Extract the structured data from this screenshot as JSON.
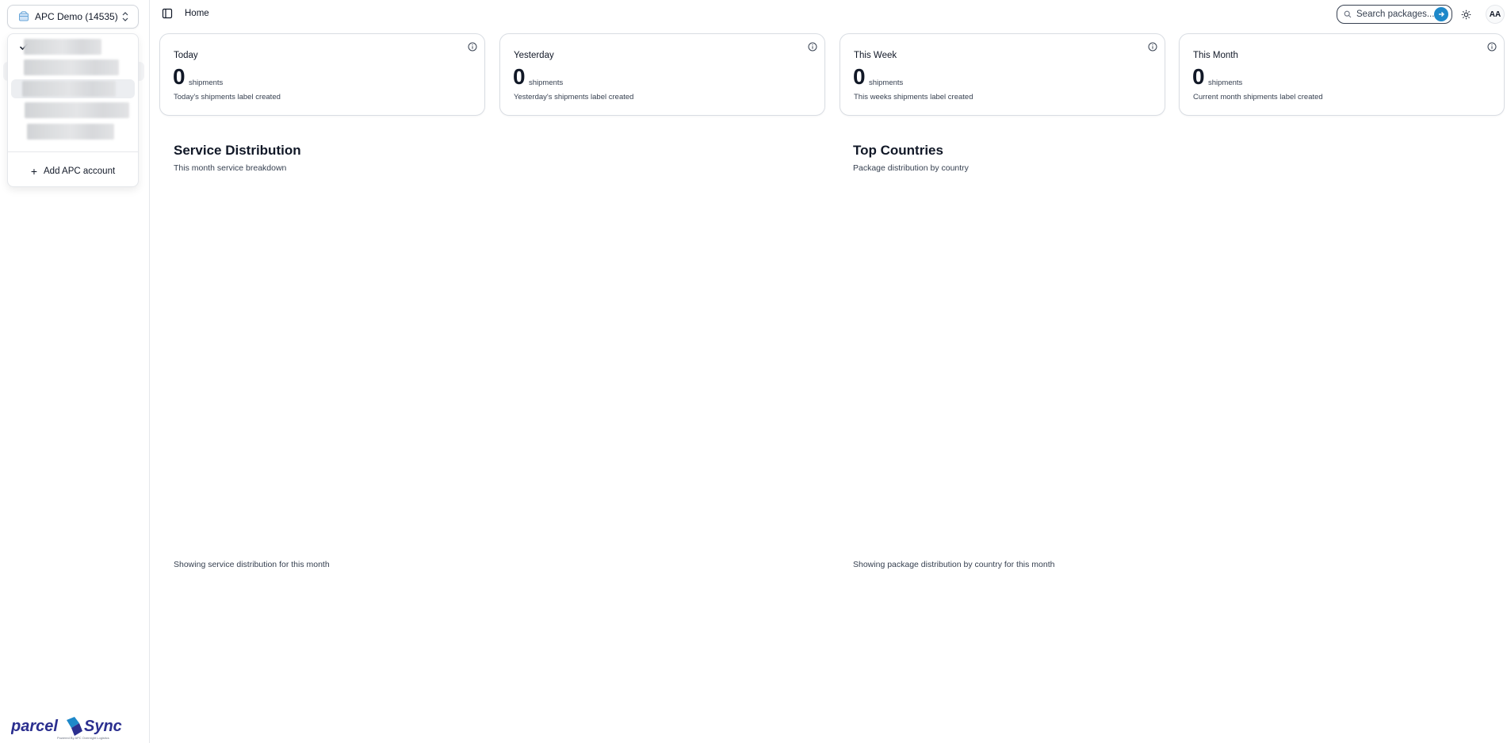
{
  "sidebar": {
    "account_switcher": {
      "label": "APC Demo (14535)"
    },
    "dropdown": {
      "add_account_label": "Add APC account",
      "partial_visible_text": ")"
    },
    "logo": {
      "text_left": "parcel",
      "text_right": "Sync",
      "tagline": "Powered By APC Overnight Logistics"
    }
  },
  "topbar": {
    "breadcrumb": "Home",
    "search_placeholder": "Search packages...",
    "avatar_initials": "AA"
  },
  "stats": [
    {
      "title": "Today",
      "value": "0",
      "unit": "shipments",
      "description": "Today's shipments label created"
    },
    {
      "title": "Yesterday",
      "value": "0",
      "unit": "shipments",
      "description": "Yesterday's shipments label created"
    },
    {
      "title": "This Week",
      "value": "0",
      "unit": "shipments",
      "description": "This weeks shipments label created"
    },
    {
      "title": "This Month",
      "value": "0",
      "unit": "shipments",
      "description": "Current month shipments label created"
    }
  ],
  "service_distribution": {
    "title": "Service Distribution",
    "subtitle": "This month service breakdown",
    "footer": "Showing service distribution for this month"
  },
  "top_countries": {
    "title": "Top Countries",
    "subtitle": "Package distribution by country",
    "footer": "Showing package distribution by country for this month"
  },
  "colors": {
    "accent": "#1e88c9",
    "logo_blue": "#2b2f8f",
    "border": "#d9dde3"
  }
}
